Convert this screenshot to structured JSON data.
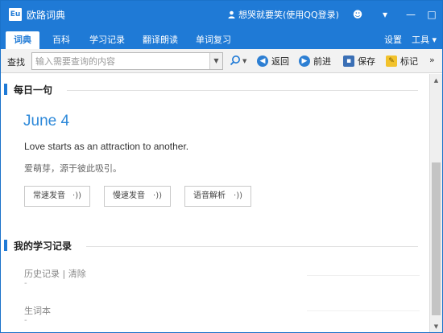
{
  "window": {
    "title": "欧路词典",
    "logo_text": "Eu",
    "user_label": "想哭就要笑(使用QQ登录)",
    "controls": {
      "skin": "☻",
      "menu": "▾",
      "minimize": "—",
      "maximize": "□",
      "close": "✕"
    }
  },
  "tabs": [
    {
      "label": "词典",
      "active": true
    },
    {
      "label": "百科",
      "active": false
    },
    {
      "label": "学习记录",
      "active": false
    },
    {
      "label": "翻译朗读",
      "active": false
    },
    {
      "label": "单词复习",
      "active": false
    }
  ],
  "tab_right": {
    "settings": "设置",
    "tools": "工具 ▾"
  },
  "toolbar": {
    "search_label": "查找",
    "search_placeholder": "输入需要查询的内容",
    "back": "返回",
    "forward": "前进",
    "save": "保存",
    "mark": "标记",
    "more": "»"
  },
  "daily": {
    "section_title": "每日一句",
    "date": "June 4",
    "sentence_en": "Love starts as an attraction to another.",
    "sentence_cn": "爱萌芽，源于彼此吸引。",
    "audio_buttons": [
      "常速发音",
      "慢速发音",
      "语音解析"
    ]
  },
  "study": {
    "section_title": "我的学习记录",
    "history_label": "历史记录 | 清除",
    "history_value": "-",
    "wordbook_label": "生词本",
    "wordbook_value": "-"
  },
  "icons": {
    "user": "user-icon",
    "search": "search-icon",
    "back": "back-arrow-icon",
    "forward": "forward-arrow-icon",
    "save": "save-icon",
    "mark": "bookmark-icon",
    "audio": "sound-wave-icon"
  },
  "colors": {
    "accent": "#1f7ad6",
    "date_text": "#2c88d9"
  }
}
